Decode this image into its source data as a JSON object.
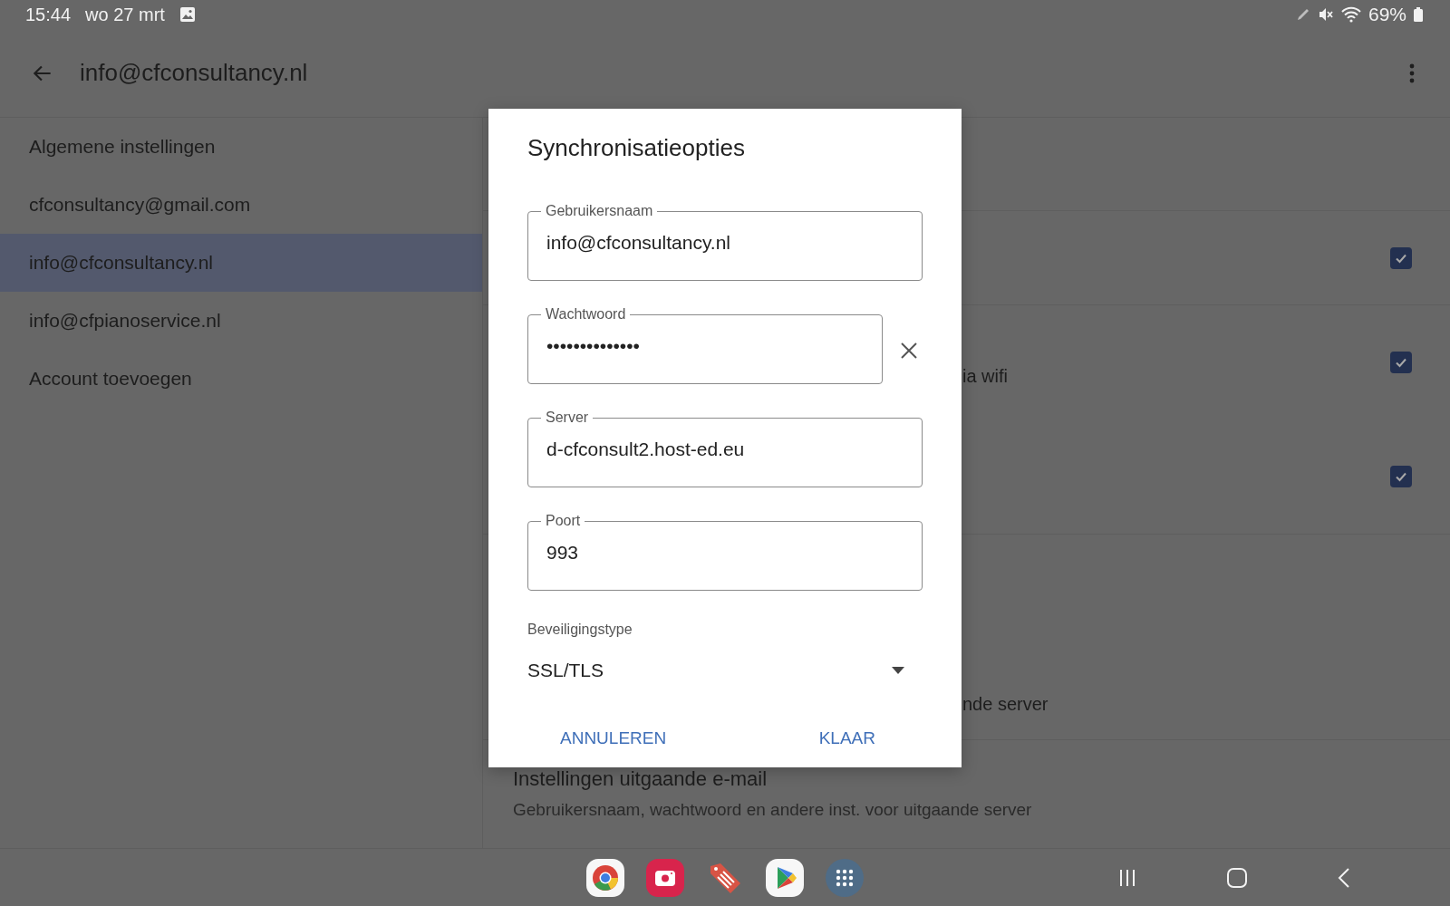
{
  "status_bar": {
    "time": "15:44",
    "date": "wo 27 mrt",
    "battery": "69%"
  },
  "app_bar": {
    "title": "info@cfconsultancy.nl"
  },
  "sidebar": {
    "items": [
      {
        "label": "Algemene instellingen",
        "selected": false
      },
      {
        "label": "cfconsultancy@gmail.com",
        "selected": false
      },
      {
        "label": "info@cfconsultancy.nl",
        "selected": true
      },
      {
        "label": "info@cfpianoservice.nl",
        "selected": false
      },
      {
        "label": "Account toevoegen",
        "selected": false
      }
    ]
  },
  "settings": {
    "sections": [
      {
        "items": [
          {
            "kind": "check",
            "checked": true
          }
        ]
      },
      {
        "items": [
          {
            "kind": "check",
            "text": "ia wifi",
            "checked": true
          },
          {
            "kind": "check",
            "checked": true
          }
        ]
      },
      {
        "items": [
          {
            "kind": "text",
            "text": "nde server"
          }
        ]
      },
      {
        "items": [
          {
            "kind": "title",
            "title": "Instellingen uitgaande e-mail",
            "subtitle": "Gebruikersnaam, wachtwoord en andere inst. voor uitgaande server"
          }
        ]
      }
    ]
  },
  "dialog": {
    "title": "Synchronisatieopties",
    "fields": [
      {
        "label": "Gebruikersnaam",
        "value": "info@cfconsultancy.nl",
        "clearable": false
      },
      {
        "label": "Wachtwoord",
        "value": "••••••••••••••",
        "clearable": true
      },
      {
        "label": "Server",
        "value": "d-cfconsult2.host-ed.eu",
        "clearable": false
      },
      {
        "label": "Poort",
        "value": "993",
        "clearable": false
      }
    ],
    "security": {
      "label": "Beveiligingstype",
      "value": "SSL/TLS"
    },
    "buttons": [
      "ANNULEREN",
      "KLAAR"
    ]
  }
}
